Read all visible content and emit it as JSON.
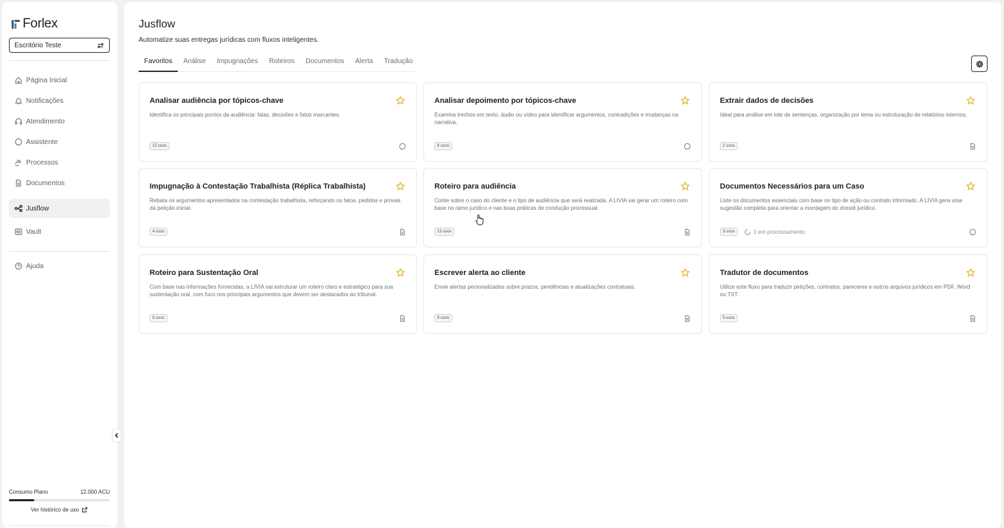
{
  "brand": {
    "name": "Forlex"
  },
  "office": {
    "name": "Escritório Teste"
  },
  "nav": {
    "items": [
      {
        "label": "Página Inicial",
        "icon": "home-icon"
      },
      {
        "label": "Notificações",
        "icon": "bell-icon"
      },
      {
        "label": "Atendimento",
        "icon": "headset-icon"
      },
      {
        "label": "Assistente",
        "icon": "chat-icon"
      },
      {
        "label": "Processos",
        "icon": "gavel-icon"
      },
      {
        "label": "Documentos",
        "icon": "document-icon"
      },
      {
        "label": "Jusflow",
        "icon": "flow-icon",
        "active": true
      },
      {
        "label": "Vault",
        "icon": "vault-icon"
      }
    ],
    "help": "Ajuda"
  },
  "plan": {
    "label": "Consumo Plano",
    "value": "12.000 ACU",
    "usage_fraction": 0.25,
    "history_link": "Ver histórico de uso"
  },
  "page": {
    "title": "Jusflow",
    "subtitle": "Automatize suas entregas jurídicas com fluxos inteligentes."
  },
  "tabs": [
    {
      "label": "Favoritos",
      "active": true
    },
    {
      "label": "Análise"
    },
    {
      "label": "Impugnações"
    },
    {
      "label": "Roteiros"
    },
    {
      "label": "Documentos"
    },
    {
      "label": "Alerta"
    },
    {
      "label": "Tradução"
    }
  ],
  "cards": [
    {
      "title": "Analisar audiência por tópicos-chave",
      "description": "Identifica os principais pontos da audiência: falas, decisões e fatos marcantes.",
      "uses": "15 usos",
      "type_icon": "chat-icon"
    },
    {
      "title": "Analisar depoimento por tópicos-chave",
      "description": "Examina trechos em texto, áudio ou vídeo para identificar argumentos, contradições e mudanças na narrativa.",
      "uses": "8 usos",
      "type_icon": "chat-icon"
    },
    {
      "title": "Extrair dados de decisões",
      "description": "Ideal para análise em lote de sentenças, organização por tema ou estruturação de relatórios internos.",
      "uses": "2 usos",
      "type_icon": "document-icon"
    },
    {
      "title": "Impugnação à Contestação Trabalhista (Réplica Trabalhista)",
      "description": "Rebata os argumentos apresentados na contestação trabalhista, reforçando os fatos, pedidos e provas da petição inicial.",
      "uses": "4 usos",
      "type_icon": "document-icon"
    },
    {
      "title": "Roteiro para audiência",
      "description": "Conte sobre o caso do cliente e o tipo de audiência que será realizada. A LIVIA vai gerar um roteiro com base no ramo jurídico e nas boas práticas de condução processual.",
      "uses": "13 usos",
      "type_icon": "document-icon"
    },
    {
      "title": "Documentos Necessários para um Caso",
      "description": "Liste os documentos essenciais com base no tipo de ação ou contrato informado. A LIVIA gera uma sugestão completa para orientar a montagem do dossiê jurídico.",
      "uses": "3 usos",
      "processing": "1 em processamento",
      "type_icon": "chat-icon"
    },
    {
      "title": "Roteiro para Sustentação Oral",
      "description": "Com base nas informações fornecidas, a LIVIA vai estruturar um roteiro claro e estratégico para sua sustentação oral, com foco nos principais argumentos que devem ser destacados ao tribunal.",
      "uses": "5 usos",
      "type_icon": "document-icon"
    },
    {
      "title": "Escrever alerta ao cliente",
      "description": "Envie alertas personalizados sobre prazos, pendências e atualizações contratuais.",
      "uses": "8 usos",
      "type_icon": "document-icon"
    },
    {
      "title": "Tradutor de documentos",
      "description": "Utilize este fluxo para traduzir petições, contratos, pareceres e outros arquivos jurídicos em PDF, Word ou TXT.",
      "uses": "5 usos",
      "type_icon": "document-icon"
    }
  ],
  "colors": {
    "star": "#e6b93a",
    "accent": "#1f2328",
    "background": "#f1f1f2"
  }
}
